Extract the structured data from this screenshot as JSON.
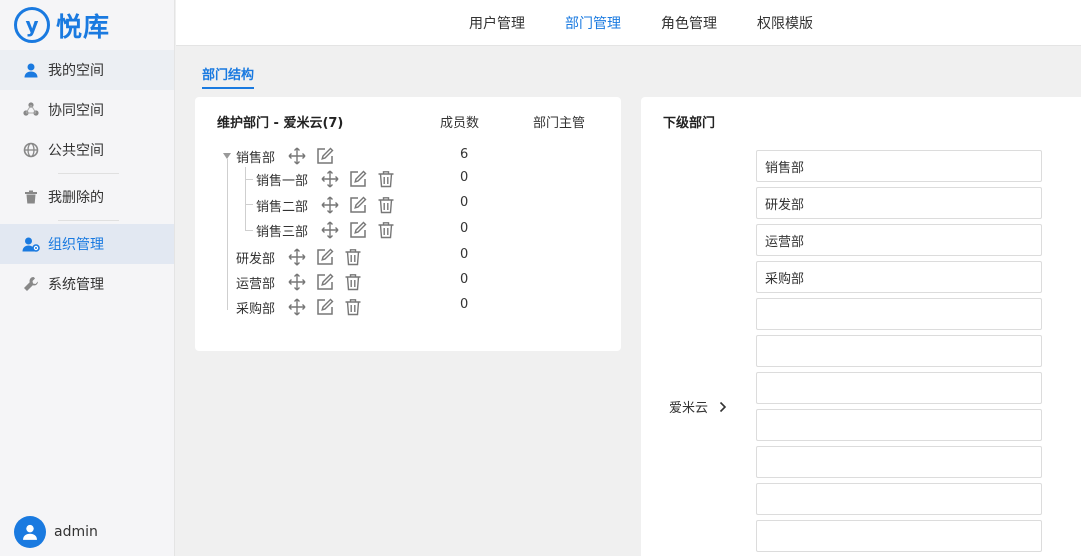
{
  "app": {
    "logo_glyph": "y",
    "logo_text": "悦库",
    "brand_color": "#1a7ae0"
  },
  "sidebar": {
    "items": [
      {
        "label": "我的空间",
        "icon": "user-icon"
      },
      {
        "label": "协同空间",
        "icon": "share-icon"
      },
      {
        "label": "公共空间",
        "icon": "globe-icon"
      },
      {
        "label": "我删除的",
        "icon": "trash-icon"
      },
      {
        "label": "组织管理",
        "icon": "org-settings-icon"
      },
      {
        "label": "系统管理",
        "icon": "wrench-icon"
      }
    ],
    "user": {
      "name": "admin"
    }
  },
  "topbar": {
    "tabs": [
      {
        "label": "用户管理"
      },
      {
        "label": "部门管理"
      },
      {
        "label": "角色管理"
      },
      {
        "label": "权限模版"
      }
    ],
    "active": "部门管理"
  },
  "subtab": {
    "label": "部门结构"
  },
  "dept_tree": {
    "title": "维护部门 - 爱米云(7)",
    "col_members": "成员数",
    "col_manager": "部门主管",
    "rows": [
      {
        "name": "销售部",
        "count": "6"
      },
      {
        "name": "销售一部",
        "count": "0"
      },
      {
        "name": "销售二部",
        "count": "0"
      },
      {
        "name": "销售三部",
        "count": "0"
      },
      {
        "name": "研发部",
        "count": "0"
      },
      {
        "name": "运营部",
        "count": "0"
      },
      {
        "name": "采购部",
        "count": "0"
      }
    ]
  },
  "sub_depts": {
    "title": "下级部门",
    "root": "爱米云",
    "values": [
      "销售部",
      "研发部",
      "运营部",
      "采购部",
      "",
      "",
      "",
      "",
      "",
      "",
      ""
    ]
  }
}
